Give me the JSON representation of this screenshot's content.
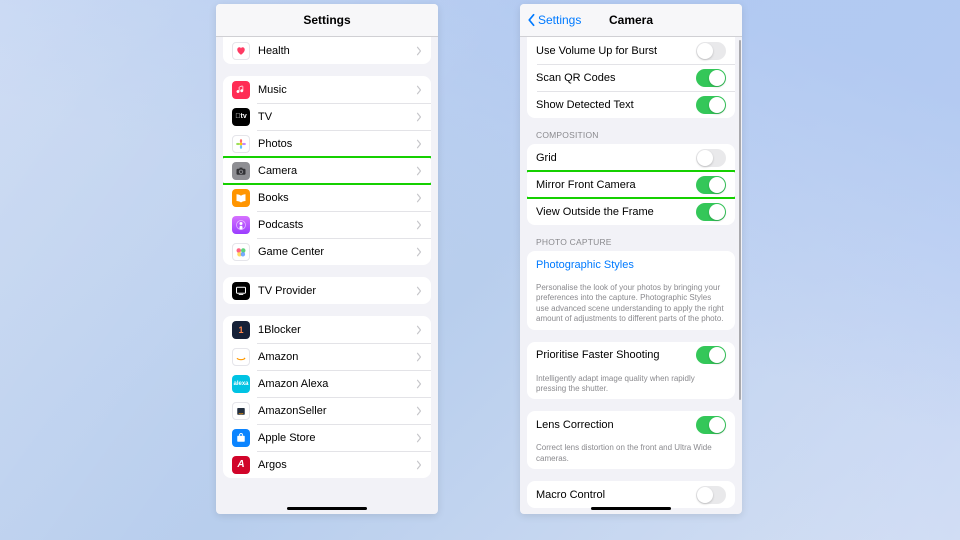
{
  "left_panel": {
    "title": "Settings",
    "groups": [
      {
        "rows": [
          {
            "id": "health",
            "label": "Health",
            "icon": {
              "bg": "#fff",
              "glyph": "heart",
              "fg": "#ff3b63"
            }
          }
        ]
      },
      {
        "rows": [
          {
            "id": "music",
            "label": "Music",
            "icon": {
              "bg": "#ff2d55",
              "glyph": "note"
            }
          },
          {
            "id": "tv",
            "label": "TV",
            "icon": {
              "bg": "#000",
              "glyph": "appletv"
            }
          },
          {
            "id": "photos",
            "label": "Photos",
            "icon": {
              "bg": "#fff",
              "glyph": "flower"
            }
          },
          {
            "id": "camera",
            "label": "Camera",
            "icon": {
              "bg": "#8e8e93",
              "glyph": "camera"
            },
            "highlight": true
          },
          {
            "id": "books",
            "label": "Books",
            "icon": {
              "bg": "#ff9500",
              "glyph": "book"
            }
          },
          {
            "id": "podcasts",
            "label": "Podcasts",
            "icon": {
              "bg": "#933d6",
              "glyph": "podcast",
              "gradient": "linear-gradient(180deg,#d671ff,#9a3dff)"
            }
          },
          {
            "id": "gamecenter",
            "label": "Game Center",
            "icon": {
              "bg": "#fff",
              "glyph": "gamecenter"
            }
          }
        ]
      },
      {
        "rows": [
          {
            "id": "tvprovider",
            "label": "TV Provider",
            "icon": {
              "bg": "#000",
              "glyph": "tvprov"
            }
          }
        ]
      },
      {
        "rows": [
          {
            "id": "oneblocker",
            "label": "1Blocker",
            "icon": {
              "bg": "#162138",
              "glyph": "1b"
            }
          },
          {
            "id": "amazon",
            "label": "Amazon",
            "icon": {
              "bg": "#fff",
              "glyph": "amazon"
            }
          },
          {
            "id": "alexa",
            "label": "Amazon Alexa",
            "icon": {
              "bg": "#00c3e3",
              "glyph": "alexa"
            }
          },
          {
            "id": "amazonseller",
            "label": "AmazonSeller",
            "icon": {
              "bg": "#fff",
              "glyph": "seller"
            }
          },
          {
            "id": "applestore",
            "label": "Apple Store",
            "icon": {
              "bg": "#0b84ff",
              "glyph": "applestore"
            }
          },
          {
            "id": "argos",
            "label": "Argos",
            "icon": {
              "bg": "#d1042a",
              "glyph": "argos"
            }
          }
        ]
      }
    ]
  },
  "right_panel": {
    "back": "Settings",
    "title": "Camera",
    "sections": [
      {
        "rows": [
          {
            "id": "volumeburst",
            "label": "Use Volume Up for Burst",
            "toggle": false
          },
          {
            "id": "qr",
            "label": "Scan QR Codes",
            "toggle": true
          },
          {
            "id": "detectedtext",
            "label": "Show Detected Text",
            "toggle": true
          }
        ]
      },
      {
        "header": "COMPOSITION",
        "rows": [
          {
            "id": "grid",
            "label": "Grid",
            "toggle": false
          },
          {
            "id": "mirror",
            "label": "Mirror Front Camera",
            "toggle": true,
            "highlight": true
          },
          {
            "id": "outsideframe",
            "label": "View Outside the Frame",
            "toggle": true
          }
        ]
      },
      {
        "header": "PHOTO CAPTURE",
        "rows": [
          {
            "id": "photostyles",
            "label": "Photographic Styles",
            "link": true,
            "note": "Personalise the look of your photos by bringing your preferences into the capture. Photographic Styles use advanced scene understanding to apply the right amount of adjustments to different parts of the photo."
          }
        ]
      },
      {
        "rows": [
          {
            "id": "fastershoot",
            "label": "Prioritise Faster Shooting",
            "toggle": true,
            "note": "Intelligently adapt image quality when rapidly pressing the shutter."
          }
        ]
      },
      {
        "rows": [
          {
            "id": "lenscorrect",
            "label": "Lens Correction",
            "toggle": true,
            "note": "Correct lens distortion on the front and Ultra Wide cameras."
          }
        ]
      },
      {
        "rows": [
          {
            "id": "macro",
            "label": "Macro Control",
            "toggle": false
          }
        ]
      }
    ]
  }
}
